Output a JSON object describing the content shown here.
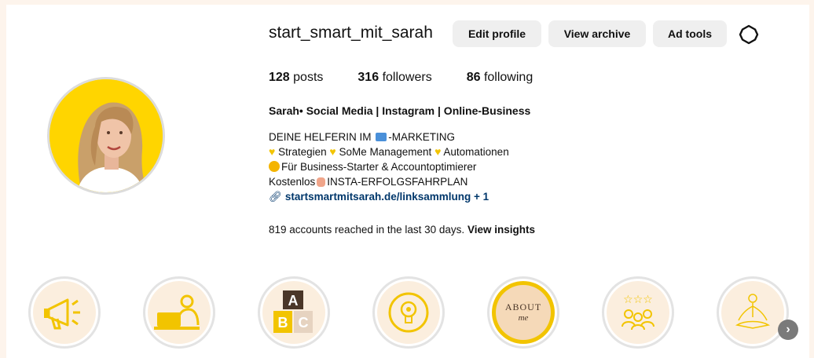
{
  "profile": {
    "username": "start_smart_mit_sarah",
    "buttons": {
      "edit": "Edit profile",
      "archive": "View archive",
      "ads": "Ad tools"
    },
    "stats": {
      "posts_count": "128",
      "posts_label": "posts",
      "followers_count": "316",
      "followers_label": "followers",
      "following_count": "86",
      "following_label": "following"
    },
    "display_name": "Sarah• Social Media | Instagram | Online-Business",
    "bio": {
      "line1_a": "DEINE HELFERIN IM",
      "line1_b": "-MARKETING",
      "line2_a": "Strategien",
      "line2_b": "SoMe Management",
      "line2_c": "Automationen",
      "line3": "Für Business-Starter & Accountoptimierer",
      "line4_a": "Kostenlos",
      "line4_b": "INSTA-ERFOLGSFAHRPLAN",
      "link": "startsmartmitsarah.de/linksammlung",
      "link_more": "+ 1"
    },
    "reach_text": "819 accounts reached in the last 30 days.",
    "reach_link": "View insights"
  },
  "highlights": {
    "about_title": "ABOUT",
    "about_sub": "me",
    "abc_letters": [
      "A",
      "B",
      "C"
    ]
  },
  "icons": {
    "gear": "gear-icon",
    "link": "link-icon",
    "next": "chevron-right-icon"
  },
  "colors": {
    "accent_yellow": "#ffd500",
    "highlight_bg": "#fbeede",
    "link": "#00376b",
    "button_bg": "#efefef"
  }
}
